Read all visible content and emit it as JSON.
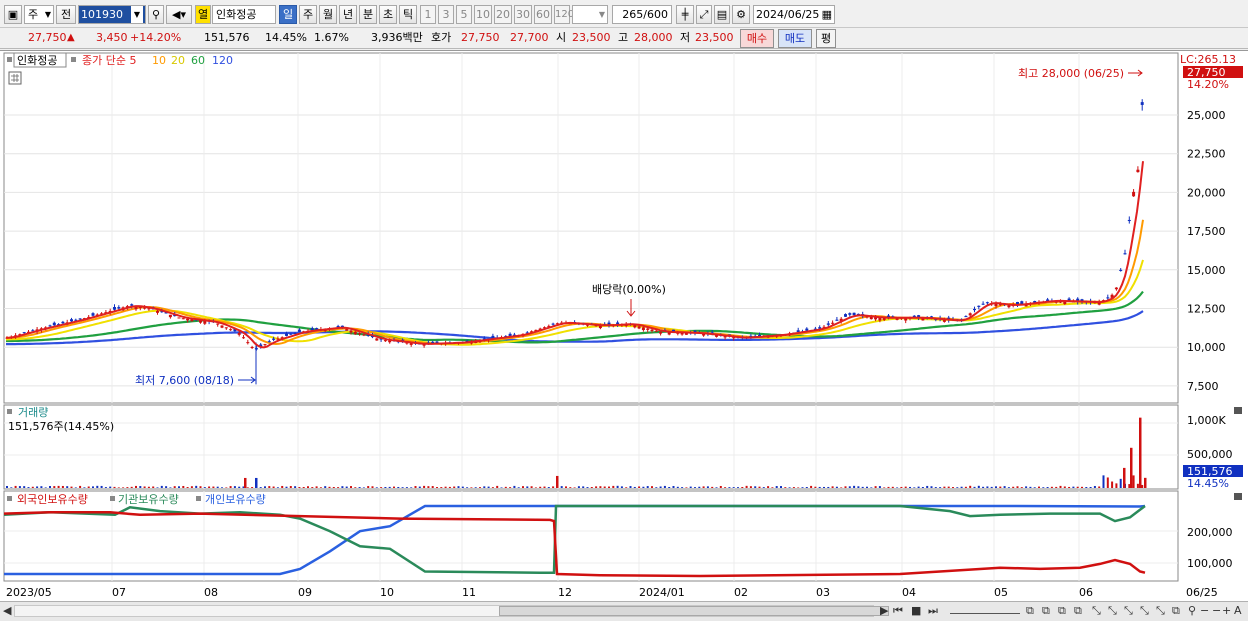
{
  "toolbar": {
    "period_type": "주",
    "compare_label": "전",
    "stock_code": "101930",
    "stock_name": "인화정공",
    "heat_badge": "열",
    "timeframes": [
      "일",
      "주",
      "월",
      "년",
      "분",
      "초",
      "틱"
    ],
    "active_timeframe": "일",
    "intervals": [
      "1",
      "3",
      "5",
      "10",
      "20",
      "30",
      "60",
      "120"
    ],
    "count": "265",
    "count_max": "/600",
    "date": "2024/06/25"
  },
  "quote": {
    "price": "27,750",
    "change": "3,450",
    "change_pct": "+14.20%",
    "volume": "151,576",
    "volume_pct": "14.45%",
    "turnover_pct": "1.67%",
    "amount": "3,936백만",
    "bid_label": "호가",
    "ask_price": "27,750",
    "bid_price": "27,700",
    "open_label": "시",
    "open": "23,500",
    "high_label": "고",
    "high": "28,000",
    "low_label": "저",
    "low": "23,500",
    "buy_button": "매수",
    "sell_button": "매도",
    "eval_button": "평"
  },
  "price_panel": {
    "legend_name": "인화정공",
    "legend_ma_label": "종가 단순 5",
    "legend_ma": [
      "10",
      "20",
      "60",
      "120"
    ],
    "lc_label": "LC:265.13",
    "last_price_tag": "27,750",
    "last_change_tag": "14.20%",
    "high_annotation": "최고 28,000 (06/25)",
    "low_annotation": "최저 7,600 (08/18)",
    "dividend_annotation": "배당락(0.00%)",
    "y_ticks": [
      "25,000",
      "22,500",
      "20,000",
      "17,500",
      "15,000",
      "12,500",
      "10,000",
      "7,500"
    ]
  },
  "volume_panel": {
    "title": "거래량",
    "value_label": "151,576주(14.45%)",
    "y_ticks": [
      "1,000K",
      "500,000"
    ],
    "last_tag": "151,576",
    "last_pct": "14.45%"
  },
  "holdings_panel": {
    "legend": [
      "외국인보유수량",
      "기관보유수량",
      "개인보유수량"
    ],
    "y_ticks": [
      "200,000",
      "100,000"
    ]
  },
  "x_axis": {
    "labels": [
      "2023/05",
      "07",
      "08",
      "09",
      "10",
      "11",
      "12",
      "2024/01",
      "02",
      "03",
      "04",
      "05",
      "06"
    ],
    "right_label": "06/25"
  },
  "colors": {
    "up": "#d01010",
    "down": "#1030c0",
    "ma5": "#e02020",
    "ma10": "#ff9a00",
    "ma20": "#f0e000",
    "ma60": "#20a040",
    "ma120": "#3050e0",
    "foreign": "#d01010",
    "institution": "#2a8a5a",
    "individual": "#2a60e0"
  },
  "chart_data": [
    {
      "type": "line",
      "title": "인화정공",
      "description_series": "daily close (approx.)",
      "x": [
        "2023/05",
        "2023/06",
        "2023/07",
        "2023/08",
        "2023/08/18",
        "2023/09",
        "2023/10",
        "2023/11",
        "2023/12",
        "2024/01",
        "2024/02",
        "2024/03",
        "2024/04",
        "2024/05",
        "2024/06",
        "2024/06/25"
      ],
      "series": [
        {
          "name": "종가",
          "values": [
            10600,
            11700,
            12800,
            11300,
            9800,
            11000,
            10200,
            10400,
            11500,
            11200,
            10700,
            11800,
            11900,
            12900,
            13000,
            27750
          ]
        }
      ],
      "ylim": [
        7000,
        28500
      ],
      "annotations": [
        {
          "label": "최고 28,000 (06/25)"
        },
        {
          "label": "최저 7,600 (08/18)"
        },
        {
          "label": "배당락(0.00%)"
        }
      ]
    },
    {
      "type": "bar",
      "title": "거래량",
      "x": [
        "2023/08",
        "2023/12",
        "2024/06 a",
        "2024/06 b",
        "2024/06/25"
      ],
      "values": [
        150000,
        180000,
        600000,
        1050000,
        151576
      ],
      "ylim": [
        0,
        1100000
      ]
    },
    {
      "type": "line",
      "title": "보유수량",
      "x": [
        "2023/05",
        "2023/07",
        "2023/09",
        "2023/10",
        "2023/11",
        "2023/12",
        "2024/01",
        "2024/03",
        "2024/05",
        "2024/06",
        "2024/06/25"
      ],
      "series": [
        {
          "name": "외국인보유수량",
          "values": [
            260000,
            270000,
            250000,
            235000,
            225000,
            30000,
            22000,
            25000,
            50000,
            70000,
            20000
          ]
        },
        {
          "name": "기관보유수량",
          "values": [
            250000,
            265000,
            250000,
            120000,
            25000,
            290000,
            290000,
            290000,
            240000,
            240000,
            290000
          ]
        },
        {
          "name": "개인보유수량",
          "values": [
            20000,
            20000,
            30000,
            190000,
            290000,
            290000,
            290000,
            290000,
            290000,
            290000,
            285000
          ]
        }
      ],
      "ylim": [
        0,
        310000
      ]
    }
  ]
}
